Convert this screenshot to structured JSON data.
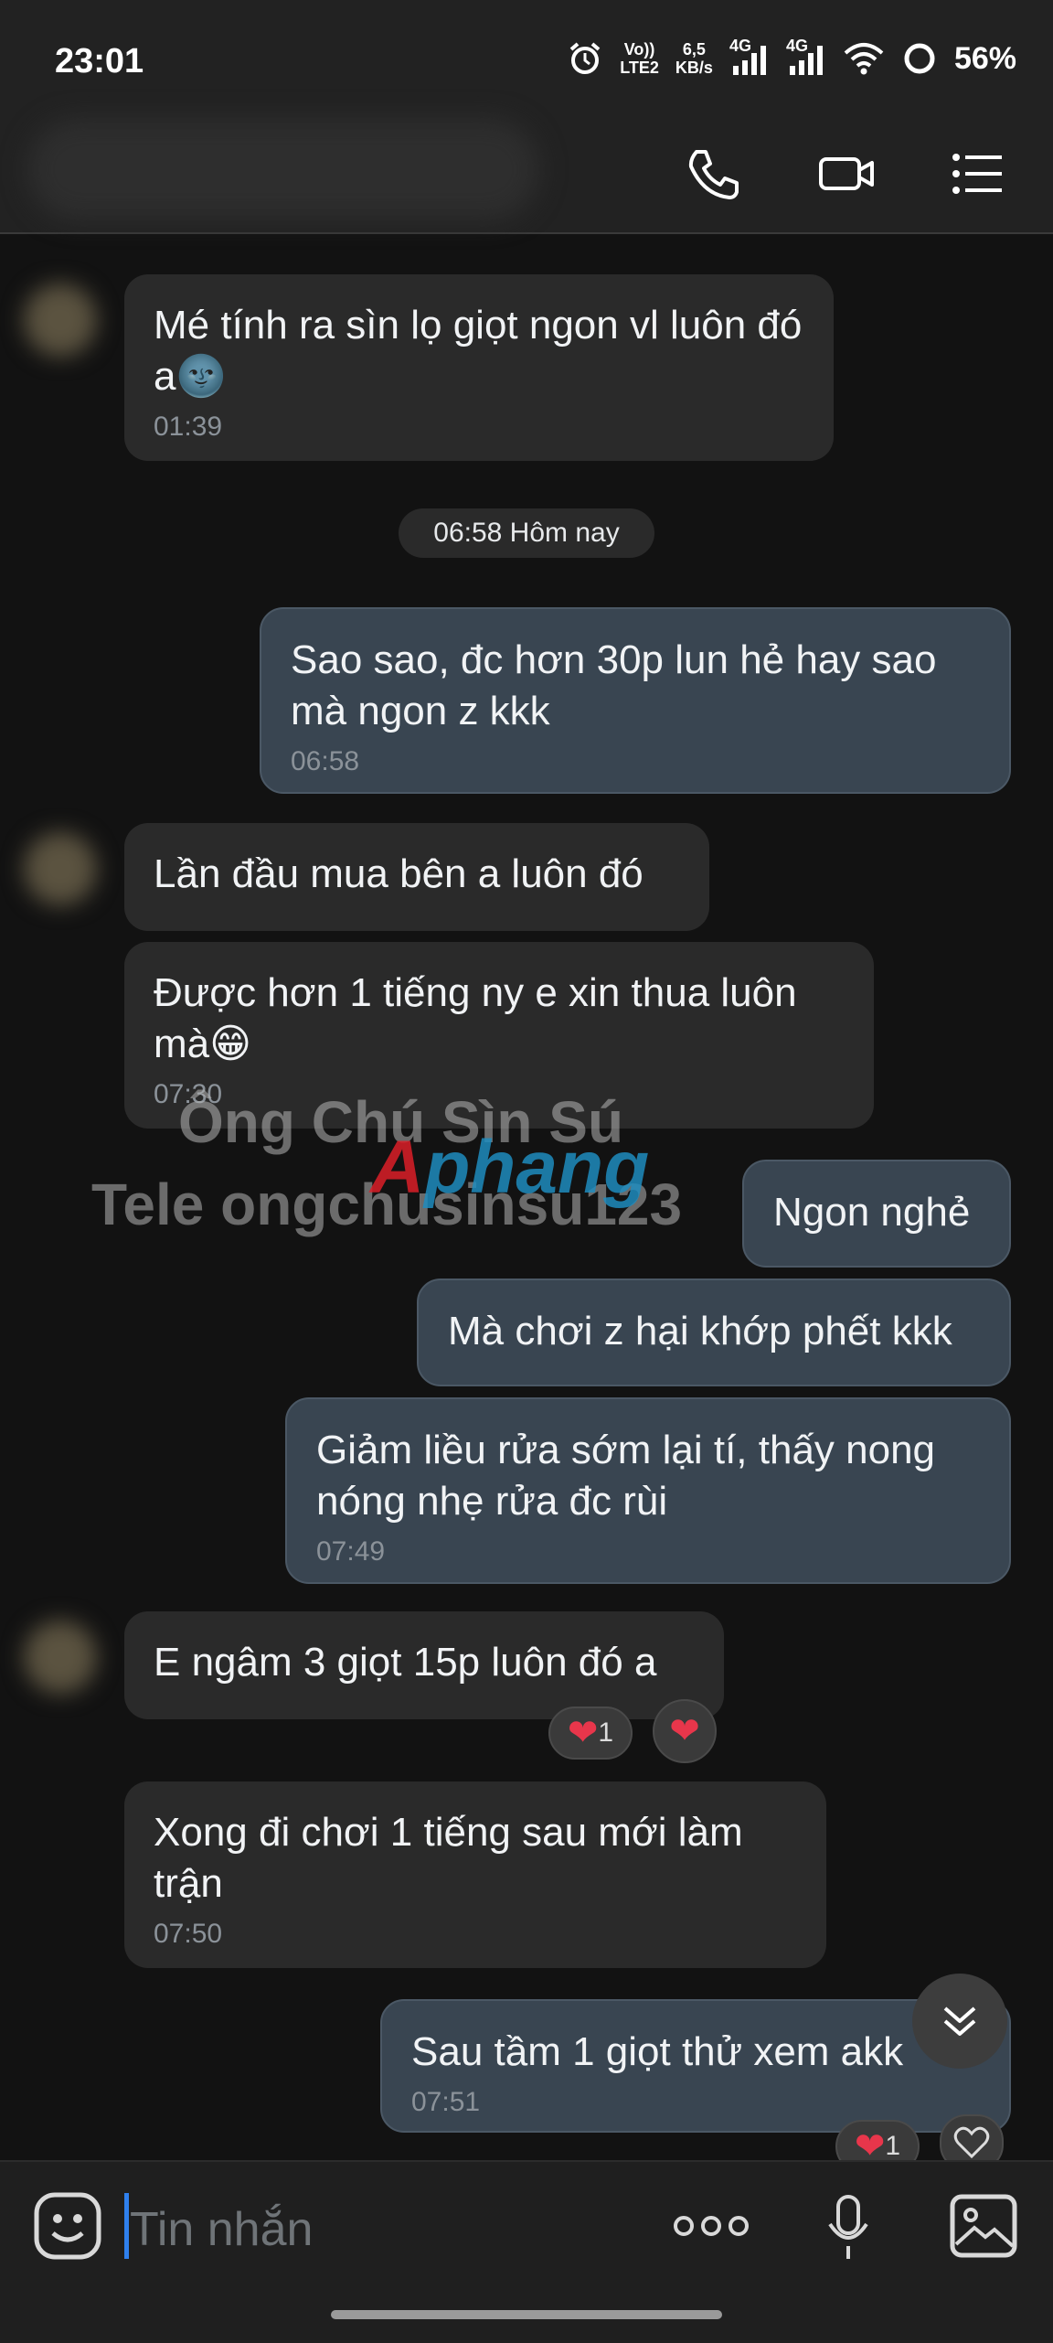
{
  "status_bar": {
    "time": "23:01",
    "volte": "Vo))",
    "lte": "LTE2",
    "speed_value": "6,5",
    "speed_unit": "KB/s",
    "network1": "4G",
    "network2": "4G",
    "battery": "56%"
  },
  "header": {
    "icons": [
      "phone-icon",
      "video-call-icon",
      "menu-icon"
    ]
  },
  "messages": [
    {
      "direction": "in",
      "text": "Mé tính ra sìn lọ giọt ngon vl luôn đó a🌚",
      "time": "01:39"
    },
    {
      "direction": "divider",
      "text": "06:58 Hôm nay"
    },
    {
      "direction": "out",
      "text": "Sao sao, đc hơn 30p lun hẻ hay sao mà ngon z kkk",
      "time": "06:58"
    },
    {
      "direction": "in",
      "text": "Lần đầu mua bên a luôn đó"
    },
    {
      "direction": "in",
      "text": "Được hơn 1 tiếng ny e xin thua luôn mà😁",
      "time": "07:30"
    },
    {
      "direction": "out",
      "text": "Ngon nghẻ"
    },
    {
      "direction": "out",
      "text": "Mà chơi z hại khớp phết kkk"
    },
    {
      "direction": "out",
      "text": "Giảm liều rửa sớm lại tí, thấy nong nóng nhẹ rửa đc rùi",
      "time": "07:49"
    },
    {
      "direction": "in",
      "text": "E ngâm 3 giọt 15p luôn đó a",
      "reaction_count": "1"
    },
    {
      "direction": "in",
      "text": "Xong đi chơi 1 tiếng sau mới làm trận",
      "time": "07:50"
    },
    {
      "direction": "out",
      "text": "Sau tầm 1 giọt thử xem akk",
      "time": "07:51",
      "reaction_count": "1"
    }
  ],
  "watermark": {
    "line1": "Ông Chú Sìn Sú",
    "line2": "Tele ongchusinsu123",
    "logo_a": "A",
    "logo_rest": "phang"
  },
  "composer": {
    "placeholder": "Tin nhắn"
  },
  "colors": {
    "incoming_bubble": "#2a2a2a",
    "outgoing_bubble": "#394551",
    "background": "#121212",
    "heart": "#e8364b"
  }
}
